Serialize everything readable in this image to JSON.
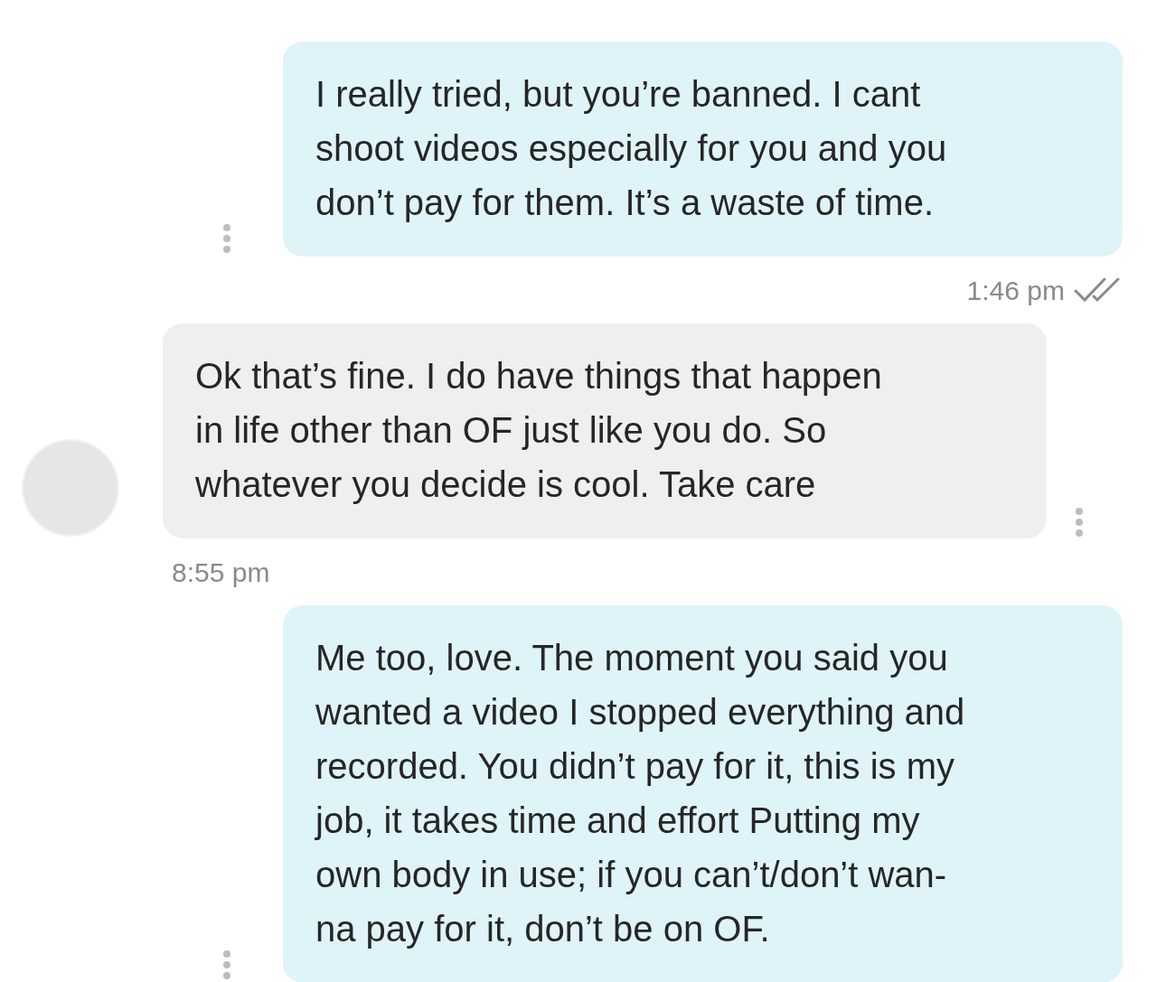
{
  "messages": [
    {
      "kind": "outgoing",
      "lines": [
        "I really tried, but you’re banned. I cant",
        "shoot videos especially for you and you",
        "don’t pay for them. It’s a waste of time."
      ],
      "time": "1:46 pm",
      "read": true
    },
    {
      "kind": "incoming",
      "lines": [
        "Ok that’s fine. I do have things that happen",
        "in life other than OF just like you do. So",
        "whatever you decide is cool. Take care"
      ],
      "time": "8:55 pm"
    },
    {
      "kind": "outgoing",
      "lines": [
        "Me too, love. The moment you said you",
        "wanted a video I stopped everything and",
        "recorded. You didn’t pay for it, this is my",
        "job, it takes time and effort Putting my",
        "own body in use; if you can’t/don’t wan-",
        "na pay for it, don’t be on OF."
      ]
    }
  ]
}
